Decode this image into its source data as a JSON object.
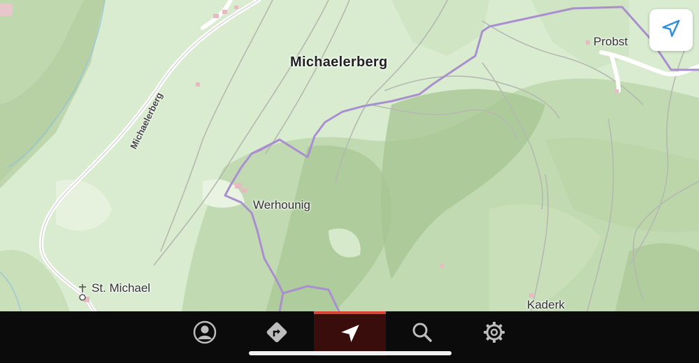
{
  "map": {
    "places": {
      "michaelerberg": "Michaelerberg",
      "probst": "Probst",
      "werhounig": "Werhounig",
      "st_michael": "St. Michael",
      "kaderk": "Kaderk"
    },
    "road_label": "Michaelerberg",
    "colors": {
      "land": "#d9ecd0",
      "forest": "#c5ddb6",
      "trail": "#a98fd0",
      "road": "#ffffff"
    }
  },
  "controls": {
    "locate_icon": "navigation-arrow-icon"
  },
  "tabbar": {
    "tabs": [
      {
        "icon": "profile-icon",
        "active": false
      },
      {
        "icon": "directions-icon",
        "active": false
      },
      {
        "icon": "navigation-arrow-icon",
        "active": true
      },
      {
        "icon": "search-icon",
        "active": false
      },
      {
        "icon": "gear-icon",
        "active": false
      }
    ],
    "accent": "#d9452f"
  }
}
